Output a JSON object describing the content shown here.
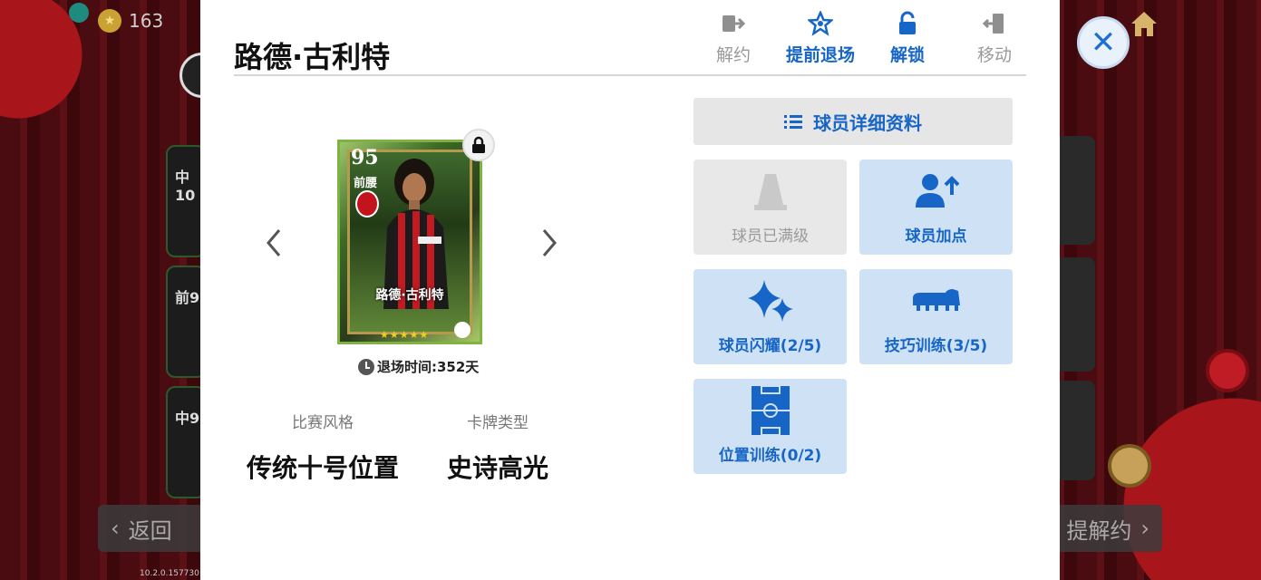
{
  "hud": {
    "coins": "163",
    "back_label": "返回",
    "version": "10.2.0.157730",
    "right_button_label": "提解约"
  },
  "background_cards": [
    {
      "label": "中10"
    },
    {
      "label": "前9"
    },
    {
      "label": "中9"
    }
  ],
  "dialog": {
    "title": "路德·古利特",
    "actions": [
      {
        "label": "解约",
        "icon": "release-icon",
        "state": "disabled"
      },
      {
        "label": "提前退场",
        "icon": "star-exit-icon",
        "state": "active"
      },
      {
        "label": "解锁",
        "icon": "unlock-icon",
        "state": "active"
      },
      {
        "label": "移动",
        "icon": "move-icon",
        "state": "disabled"
      }
    ],
    "card": {
      "rating": "95",
      "position": "前腰",
      "name": "路德·古利特",
      "stars": "★★★★★",
      "club_badge": "ac-milan-badge",
      "accent": "#7fb341"
    },
    "retire_label": "退场时间:352天",
    "play_style": {
      "label": "比赛风格",
      "value": "传统十号位置"
    },
    "card_type": {
      "label": "卡牌类型",
      "value": "史诗高光"
    },
    "detail_button": "球员详细资料",
    "tiles": [
      {
        "label": "球员已满级",
        "icon": "cone-icon",
        "state": "disabled"
      },
      {
        "label": "球员加点",
        "icon": "player-add-points-icon",
        "state": "enabled"
      },
      {
        "label": "球员闪耀(2/5)",
        "icon": "sparkle-icon",
        "state": "enabled"
      },
      {
        "label": "技巧训练(3/5)",
        "icon": "boot-icon",
        "state": "enabled"
      },
      {
        "label": "位置训练(0/2)",
        "icon": "pitch-icon",
        "state": "enabled"
      }
    ]
  },
  "colors": {
    "accent_blue": "#1766c7",
    "tile_blue": "#cfe2f5",
    "tile_grey": "#e8e8e8",
    "close_blue": "#1e6fd0"
  }
}
